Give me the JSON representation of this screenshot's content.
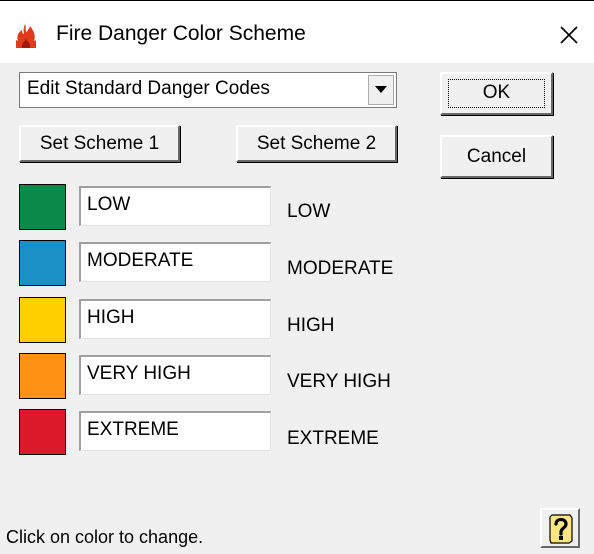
{
  "window": {
    "title": "Fire Danger Color Scheme",
    "icon": "flame-icon",
    "close_icon": "close-icon"
  },
  "combo": {
    "selected": "Edit Standard Danger Codes",
    "icon": "chevron-down-icon"
  },
  "buttons": {
    "ok": "OK",
    "cancel": "Cancel",
    "scheme1": "Set Scheme 1",
    "scheme2": "Set Scheme 2",
    "help_icon": "help-question-icon"
  },
  "codes": [
    {
      "field": "LOW",
      "label": "LOW",
      "color": "#0a8a4a"
    },
    {
      "field": "MODERATE",
      "label": "MODERATE",
      "color": "#1a90c4"
    },
    {
      "field": "HIGH",
      "label": "HIGH",
      "color": "#ffd000"
    },
    {
      "field": "VERY HIGH",
      "label": "VERY HIGH",
      "color": "#ff9214"
    },
    {
      "field": "EXTREME",
      "label": "EXTREME",
      "color": "#dd1a2c"
    }
  ],
  "status": "Click on color to change."
}
